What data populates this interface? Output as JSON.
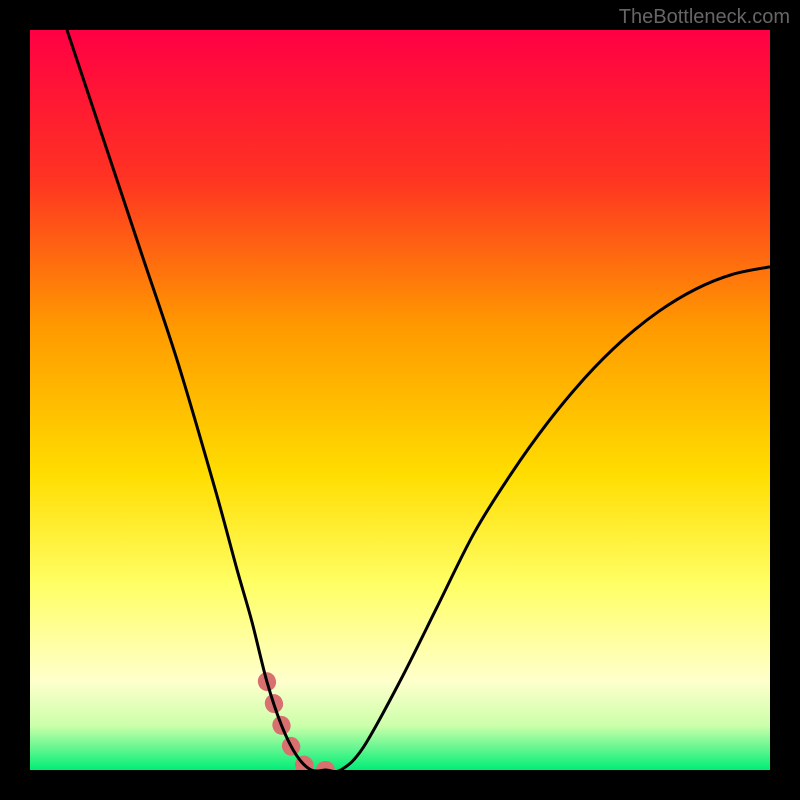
{
  "watermark": "TheBottleneck.com",
  "chart_data": {
    "type": "line",
    "title": "",
    "xlabel": "",
    "ylabel": "",
    "xlim": [
      0,
      100
    ],
    "ylim": [
      0,
      100
    ],
    "series": [
      {
        "name": "curve",
        "x": [
          5,
          10,
          15,
          20,
          25,
          28,
          30,
          32,
          34,
          36,
          38,
          40,
          42,
          45,
          50,
          55,
          60,
          65,
          70,
          75,
          80,
          85,
          90,
          95,
          100
        ],
        "y": [
          100,
          85,
          70,
          55,
          38,
          27,
          20,
          12,
          6,
          2,
          0,
          0,
          0,
          3,
          12,
          22,
          32,
          40,
          47,
          53,
          58,
          62,
          65,
          67,
          68
        ]
      }
    ],
    "highlight_range_x": [
      31,
      44
    ],
    "gradient_stops": [
      {
        "offset": 0,
        "color": "#ff0044"
      },
      {
        "offset": 20,
        "color": "#ff3322"
      },
      {
        "offset": 40,
        "color": "#ff9900"
      },
      {
        "offset": 60,
        "color": "#ffdd00"
      },
      {
        "offset": 75,
        "color": "#ffff66"
      },
      {
        "offset": 88,
        "color": "#ffffcc"
      },
      {
        "offset": 94,
        "color": "#ccffaa"
      },
      {
        "offset": 100,
        "color": "#00ee77"
      }
    ],
    "highlight_color": "#d87070",
    "curve_color": "#000000"
  }
}
